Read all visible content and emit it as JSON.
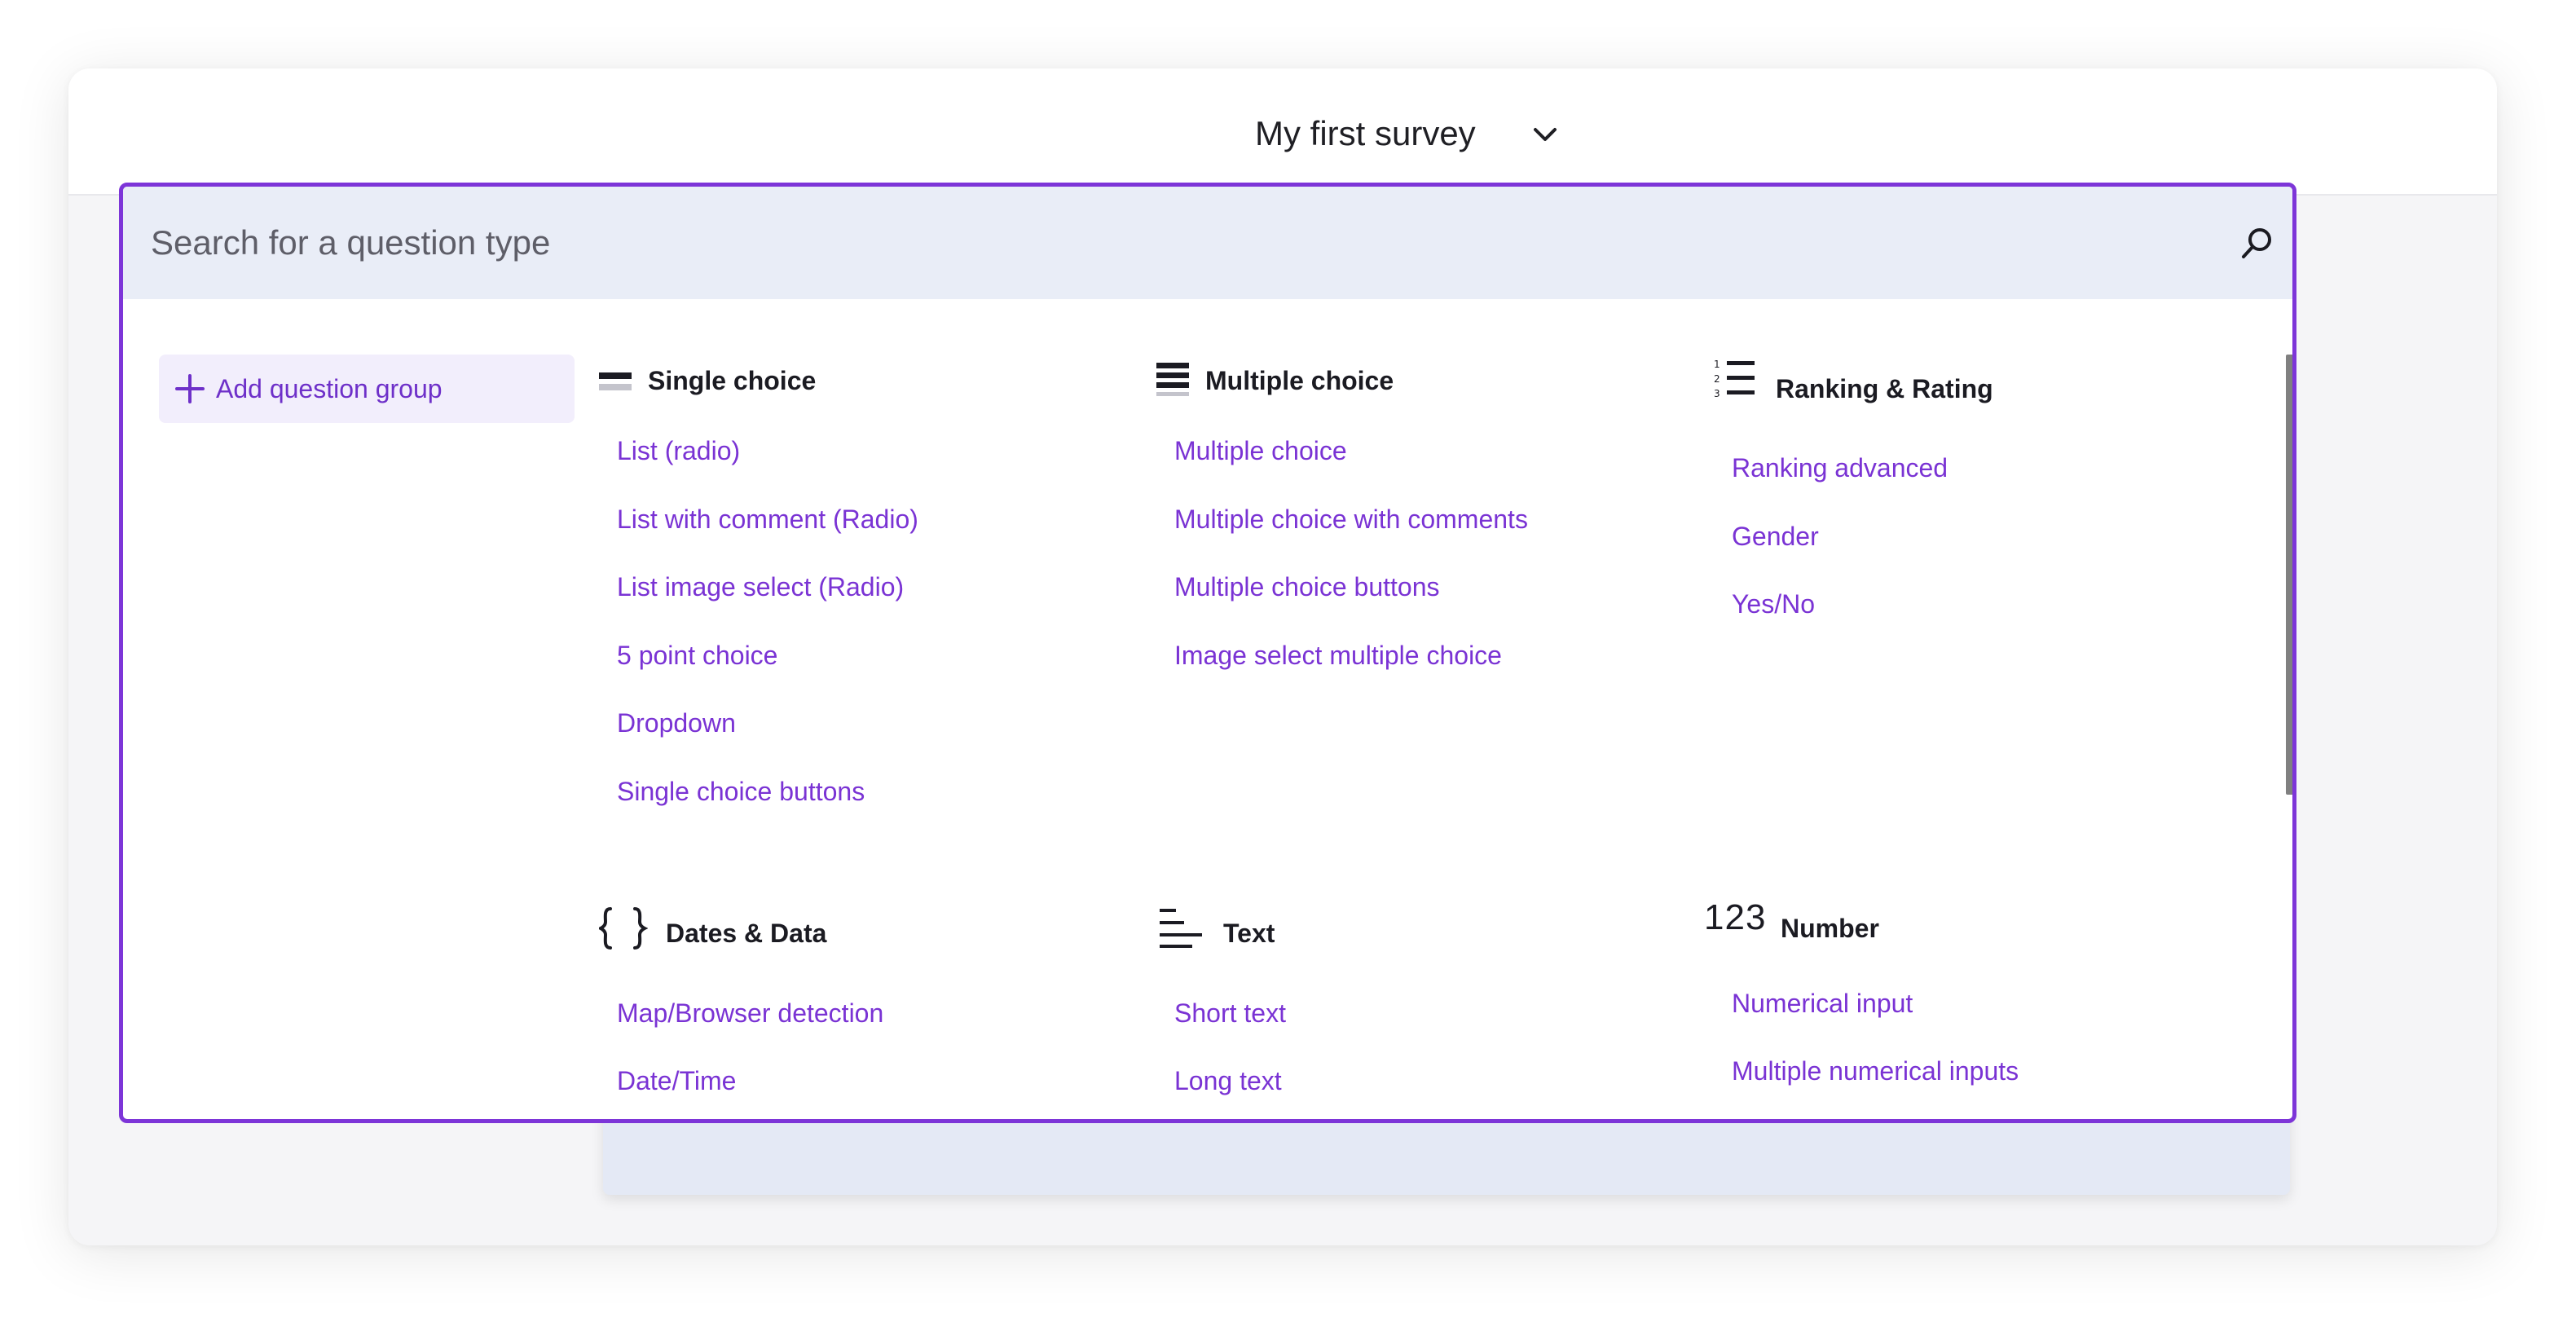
{
  "app": {
    "survey_title": "My first survey"
  },
  "search": {
    "placeholder": "Search for a question type"
  },
  "sidebar": {
    "add_group_label": "Add question group"
  },
  "categories": [
    {
      "title": "Single choice",
      "icon": "single-choice-icon",
      "items": [
        "List (radio)",
        "List with comment (Radio)",
        "List image select (Radio)",
        "5 point choice",
        "Dropdown",
        "Single choice buttons"
      ]
    },
    {
      "title": "Multiple choice",
      "icon": "multiple-choice-icon",
      "items": [
        "Multiple choice",
        "Multiple choice with comments",
        "Multiple choice buttons",
        "Image select multiple choice"
      ]
    },
    {
      "title": "Ranking & Rating",
      "icon": "ranked-list-icon",
      "items": [
        "Ranking advanced",
        "Gender",
        "Yes/No"
      ]
    },
    {
      "title": "Dates & Data",
      "icon": "curly-braces-icon",
      "items": [
        "Map/Browser detection",
        "Date/Time"
      ]
    },
    {
      "title": "Text",
      "icon": "text-lines-icon",
      "items": [
        "Short text",
        "Long text"
      ]
    },
    {
      "title": "Number",
      "icon": "number-icon",
      "icon_text": "123",
      "items": [
        "Numerical input",
        "Multiple numerical inputs"
      ]
    }
  ],
  "colors": {
    "accent": "#7d35d8",
    "link": "#7a33d4",
    "search_bg": "#e9edf7",
    "button_bg": "#f2eefc"
  }
}
